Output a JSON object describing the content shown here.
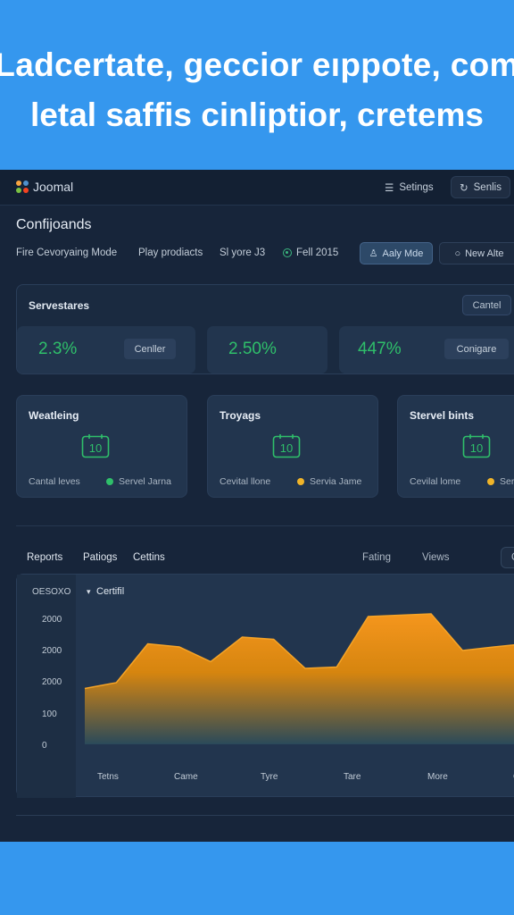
{
  "hero": {
    "line1": "Ladcertate, geccior eıppote, com",
    "line2": "letal saffis cinliptior, cretems"
  },
  "topbar": {
    "app_name": "Joomal",
    "settings_label": "Setings",
    "senlis_label": "Senlis"
  },
  "page": {
    "title": "Confijoands",
    "tool1": "Fire Cevoryaing Mode",
    "tool2": "Play prodiacts",
    "tool3": "Sl yore J3",
    "status": "Fell 2015",
    "apply_label": "Aaly Mde",
    "new_label": "New  Alte"
  },
  "servestares": {
    "title": "Servestares",
    "cantel_label": "Cantel",
    "metrics": [
      {
        "value": "2.3%",
        "button": "Cenller"
      },
      {
        "value": "2.50%",
        "button": ""
      },
      {
        "value": "447%",
        "button": "Conigare"
      }
    ]
  },
  "cards": [
    {
      "title": "Weatleing",
      "icon": "calendar-icon",
      "left_label": "Cantal leves",
      "status_label": "Servel Jarna",
      "status_color": "#2fbf6a"
    },
    {
      "title": "Troyags",
      "icon": "calendar-icon",
      "left_label": "Cevital llone",
      "status_label": "Servia Jame",
      "status_color": "#f0b429"
    },
    {
      "title": "Stervel bints",
      "icon": "calendar-icon",
      "left_label": "Cevilal lome",
      "status_label": "Serv",
      "status_color": "#f0b429"
    }
  ],
  "tabs": {
    "reports": "Reports",
    "patiogs": "Patiogs",
    "cettins": "Cettins",
    "fating": "Fating",
    "views": "Views",
    "extra": "C"
  },
  "chart_data": {
    "type": "area",
    "title": "Certifil",
    "y_top_label": "OESOXO",
    "y_tick_labels": [
      "2000",
      "2000",
      "2000",
      "100",
      "0"
    ],
    "x_tick_labels": [
      "Tetns",
      "Came",
      "Tyre",
      "Tare",
      "More",
      "C"
    ],
    "fill_color": "#f5961d",
    "x": [
      0,
      0.5,
      1,
      1.5,
      2,
      2.5,
      3,
      3.5,
      4,
      4.5,
      5,
      5.5,
      6,
      6.5,
      7
    ],
    "y": [
      1250,
      1380,
      2250,
      2180,
      1850,
      2400,
      2350,
      1700,
      1730,
      2860,
      2890,
      2920,
      2100,
      2180,
      2250
    ]
  }
}
